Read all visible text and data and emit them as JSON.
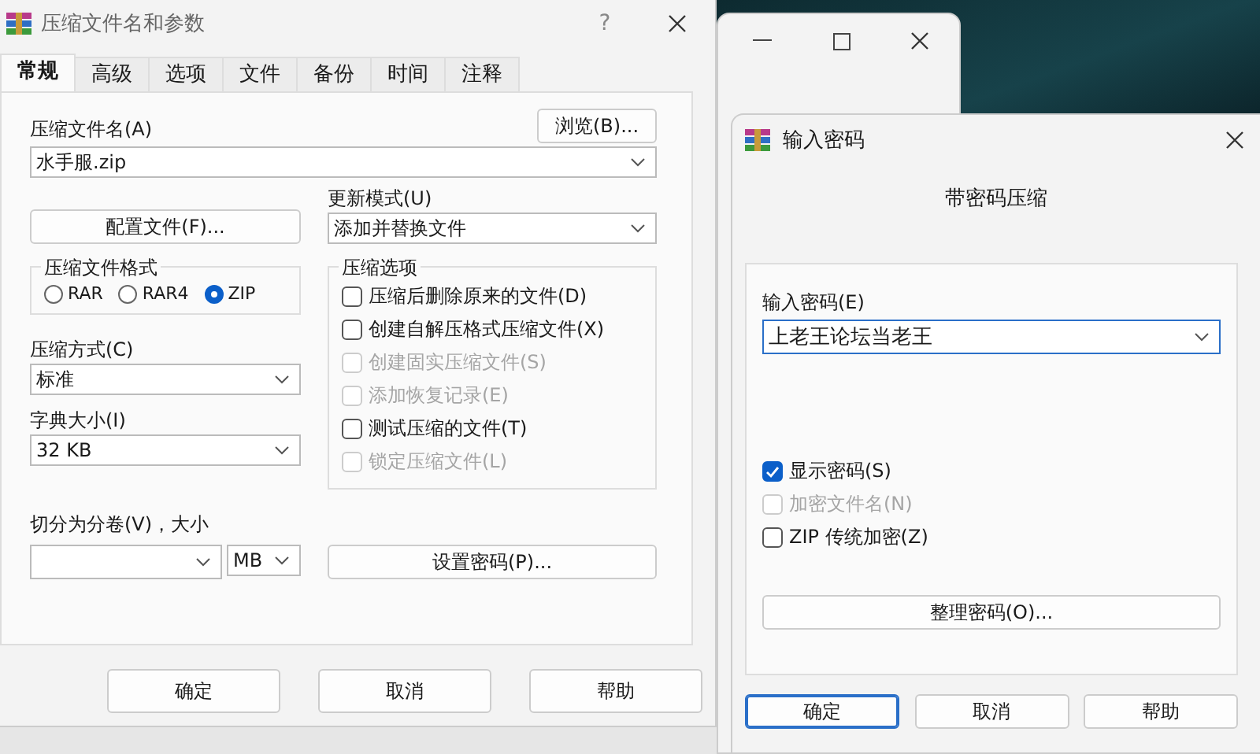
{
  "main_dialog": {
    "title": "压缩文件名和参数",
    "help": "?",
    "tabs": [
      {
        "label": "常规",
        "selected": true
      },
      {
        "label": "高级",
        "selected": false
      },
      {
        "label": "选项",
        "selected": false
      },
      {
        "label": "文件",
        "selected": false
      },
      {
        "label": "备份",
        "selected": false
      },
      {
        "label": "时间",
        "selected": false
      },
      {
        "label": "注释",
        "selected": false
      }
    ],
    "archive_name": {
      "label": "压缩文件名(A)",
      "value": "水手服.zip",
      "browse": "浏览(B)..."
    },
    "profiles_button": "配置文件(F)...",
    "update_mode": {
      "label": "更新模式(U)",
      "value": "添加并替换文件"
    },
    "format": {
      "title": "压缩文件格式",
      "options": [
        {
          "label": "RAR",
          "selected": false
        },
        {
          "label": "RAR4",
          "selected": false
        },
        {
          "label": "ZIP",
          "selected": true
        }
      ]
    },
    "method": {
      "label": "压缩方式(C)",
      "value": "标准"
    },
    "dictionary": {
      "label": "字典大小(I)",
      "value": "32 KB"
    },
    "split": {
      "label": "切分为分卷(V)，大小",
      "unit": "MB"
    },
    "options": {
      "title": "压缩选项",
      "items": [
        {
          "label": "压缩后删除原来的文件(D)",
          "checked": false,
          "disabled": false
        },
        {
          "label": "创建自解压格式压缩文件(X)",
          "checked": false,
          "disabled": false
        },
        {
          "label": "创建固实压缩文件(S)",
          "checked": false,
          "disabled": true
        },
        {
          "label": "添加恢复记录(E)",
          "checked": false,
          "disabled": true
        },
        {
          "label": "测试压缩的文件(T)",
          "checked": false,
          "disabled": false
        },
        {
          "label": "锁定压缩文件(L)",
          "checked": false,
          "disabled": true
        }
      ]
    },
    "set_password_button": "设置密码(P)...",
    "buttons": [
      {
        "label": "确定",
        "default": false
      },
      {
        "label": "取消",
        "default": false
      },
      {
        "label": "帮助",
        "default": false
      }
    ]
  },
  "password_dialog": {
    "title": "输入密码",
    "heading": "带密码压缩",
    "password": {
      "label": "输入密码(E)",
      "value": "上老王论坛当老王"
    },
    "checkboxes": [
      {
        "label": "显示密码(S)",
        "checked": true,
        "disabled": false
      },
      {
        "label": "加密文件名(N)",
        "checked": false,
        "disabled": true
      },
      {
        "label": "ZIP 传统加密(Z)",
        "checked": false,
        "disabled": false
      }
    ],
    "organize_button": "整理密码(O)...",
    "buttons": [
      {
        "label": "确定",
        "default": true
      },
      {
        "label": "取消",
        "default": false
      },
      {
        "label": "帮助",
        "default": false
      }
    ]
  }
}
